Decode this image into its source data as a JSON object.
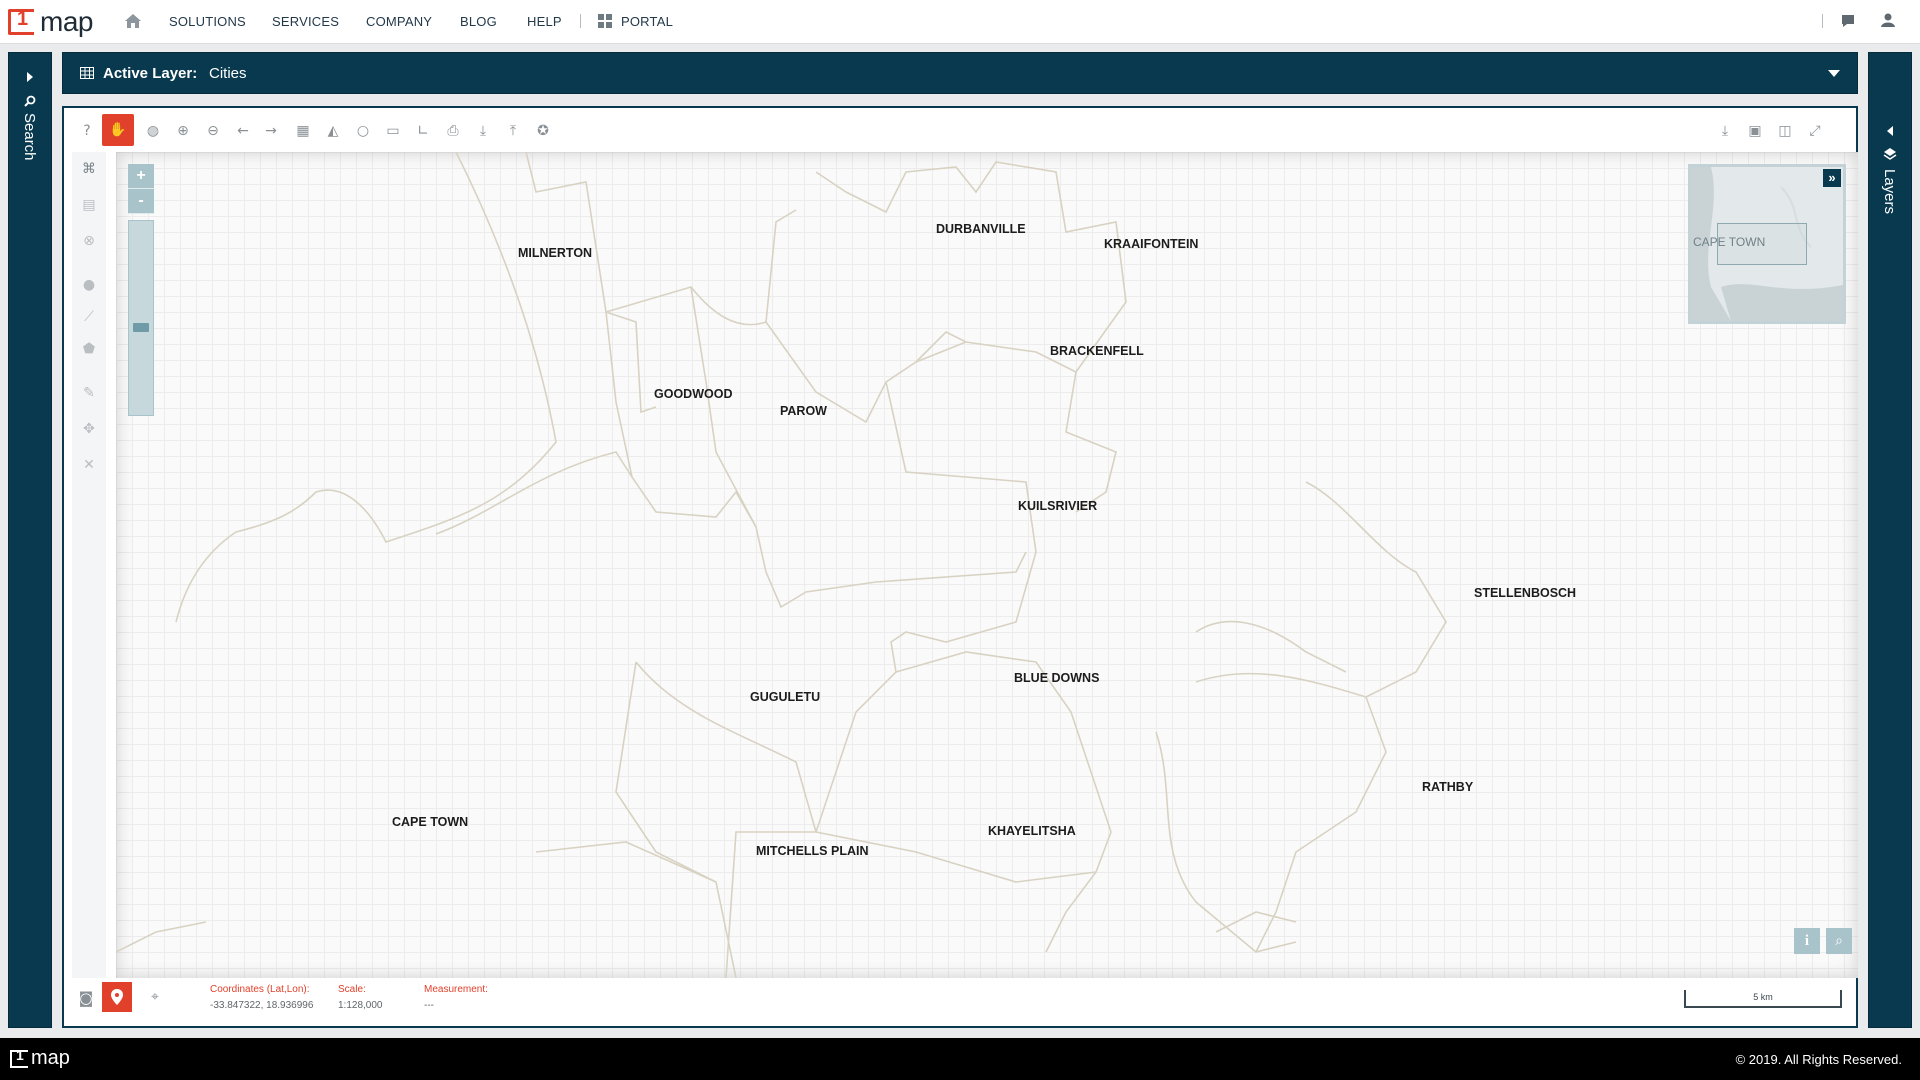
{
  "nav": {
    "logo_one": "1",
    "logo_text": "map",
    "items": [
      "SOLUTIONS",
      "SERVICES",
      "COMPANY",
      "BLOG",
      "HELP"
    ],
    "portal": "PORTAL"
  },
  "left_panel": {
    "label": "Search"
  },
  "right_panel": {
    "label": "Layers"
  },
  "active_layer": {
    "prefix": "Active Layer:",
    "name": "Cities"
  },
  "map": {
    "cities": [
      {
        "name": "MILNERTON"
      },
      {
        "name": "DURBANVILLE"
      },
      {
        "name": "KRAAIFONTEIN"
      },
      {
        "name": "BRACKENFELL"
      },
      {
        "name": "GOODWOOD"
      },
      {
        "name": "PAROW"
      },
      {
        "name": "KUILSRIVIER"
      },
      {
        "name": "STELLENBOSCH"
      },
      {
        "name": "BLUE DOWNS"
      },
      {
        "name": "GUGULETU"
      },
      {
        "name": "RATHBY"
      },
      {
        "name": "CAPE TOWN"
      },
      {
        "name": "KHAYELITSHA"
      },
      {
        "name": "MITCHELLS PLAIN"
      }
    ],
    "zoom_in": "+",
    "zoom_out": "-",
    "zoom_level_fraction": 0.55,
    "overview_label": "CAPE TOWN",
    "overview_toggle": "»"
  },
  "status": {
    "coords_label": "Coordinates (Lat,Lon):",
    "coords_value": "-33.847322, 18.936996",
    "scale_label": "Scale:",
    "scale_value": "1:128,000",
    "measure_label": "Measurement:",
    "measure_value": "---",
    "scalebar": "5 km"
  },
  "footer": {
    "logo_one": "1",
    "logo_text": "map",
    "copyright": "© 2019. All Rights Reserved."
  }
}
